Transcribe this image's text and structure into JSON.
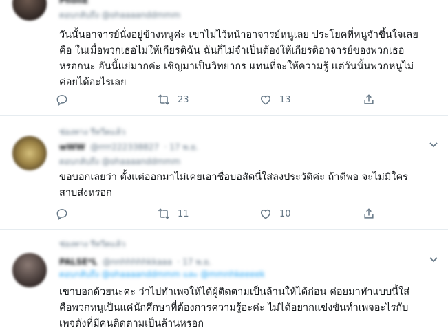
{
  "tweets": [
    {
      "retweet_context": "",
      "name": "Ph0nE",
      "handle": "@sHaaareedddmmm",
      "time": "",
      "reply_to": "ตอบกลับถึง @ohaaaanddmmm",
      "body_lines": [
        "วันนั้นอาจารย์นั่งอยู่ข้างหนูค่ะ เขาไม่ไว้หน้าอาจารย์หนูเลย ประโยคที่หนูจำขึ้นใจเลย",
        "คือ ในเมื่อพวกเธอไม่ให้เกียรติฉัน ฉันก็ไม่จำเป็นต้องให้เกียรติอาจารย์ของพวกเธอ",
        "หรอกนะ อันนี้แย่มากค่ะ เชิญมาเป็นวิทยากร แทนที่จะให้ความรู้ แต่วันนั้นพวกหนูไม่",
        "ค่อยได้อะไรเลย"
      ],
      "stats": {
        "replies": "",
        "retweets": "23",
        "likes": "13"
      }
    },
    {
      "retweet_context": "ช่องทาง รีทวีตแล้ว",
      "name": "wWW",
      "handle": "@rrrr222338827",
      "time": "17 พ.ย.",
      "reply_to": "ตอบกลับถึง @ohaaaanddmmm",
      "body_lines": [
        "ขอบอกเลยว่า ตั้งแต่ออกมาไม่เคยเอาชื่อบอสัดนี่ใส่ลงประวัติค่ะ ถ้าดีพอ จะไม่มีใคร",
        "สาบส่งหรอก"
      ],
      "stats": {
        "replies": "",
        "retweets": "11",
        "likes": "10"
      }
    },
    {
      "retweet_context": "ช่องทาง รีทวีตแล้ว",
      "name": "PALSE*L",
      "handle": "@nnhhhhhkkaaa",
      "time": "17 พ.ย.",
      "reply_to": "ตอบกลับถึง @ohaaaanddmmm และ @mmnhkeeeek",
      "body_lines": [
        "เขาบอกด้วยนะคะ ว่าไปทำเพจให้ได้ผู้ติดตามเป็นล้านให้ได้ก่อน ค่อยมาทำแบบนี้ใส่",
        "คือพวกหนูเป็นแค่นักศึกษาที่ต้องการความรู้อะค่ะ ไม่ได้อยากแข่งขันทำเพจอะไรกับ",
        "เพจดังที่มีคนติดตามเป็นล้านหรอก"
      ],
      "stats": {
        "replies": "",
        "retweets": "",
        "likes": ""
      }
    }
  ],
  "colors": {
    "text": "#14171a",
    "muted": "#657786",
    "link": "#1da1f2",
    "border": "#e6ecf0"
  },
  "icons": [
    "reply-icon",
    "retweet-icon",
    "like-icon",
    "share-icon",
    "chevron-down-icon"
  ]
}
